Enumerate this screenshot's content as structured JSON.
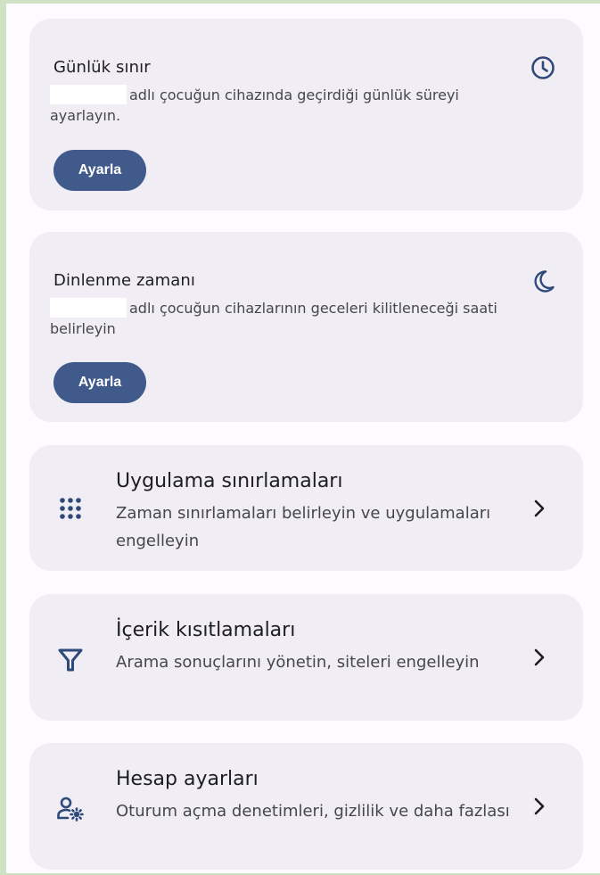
{
  "daily_limit": {
    "title": "Günlük sınır",
    "description": "adlı çocuğun cihazında geçirdiği günlük süreyi ayarlayın.",
    "button": "Ayarla",
    "icon": "clock-icon"
  },
  "downtime": {
    "title": "Dinlenme zamanı",
    "description": "adlı çocuğun cihazlarının geceleri kilitleneceği saati belirleyin",
    "button": "Ayarla",
    "icon": "moon-icon"
  },
  "rows": [
    {
      "title": "Uygulama sınırlamaları",
      "subtitle": "Zaman sınırlamaları belirleyin ve uygulamaları engelleyin",
      "icon": "apps-grid-icon"
    },
    {
      "title": "İçerik kısıtlamaları",
      "subtitle": "Arama sonuçlarını yönetin, siteleri engelleyin",
      "icon": "filter-icon"
    },
    {
      "title": "Hesap ayarları",
      "subtitle": "Oturum açma denetimleri, gizlilik ve daha fazlası",
      "icon": "account-settings-icon"
    }
  ],
  "colors": {
    "card": "#f0eef4",
    "button": "#3f5a8b",
    "icon": "#2f4a7a"
  }
}
